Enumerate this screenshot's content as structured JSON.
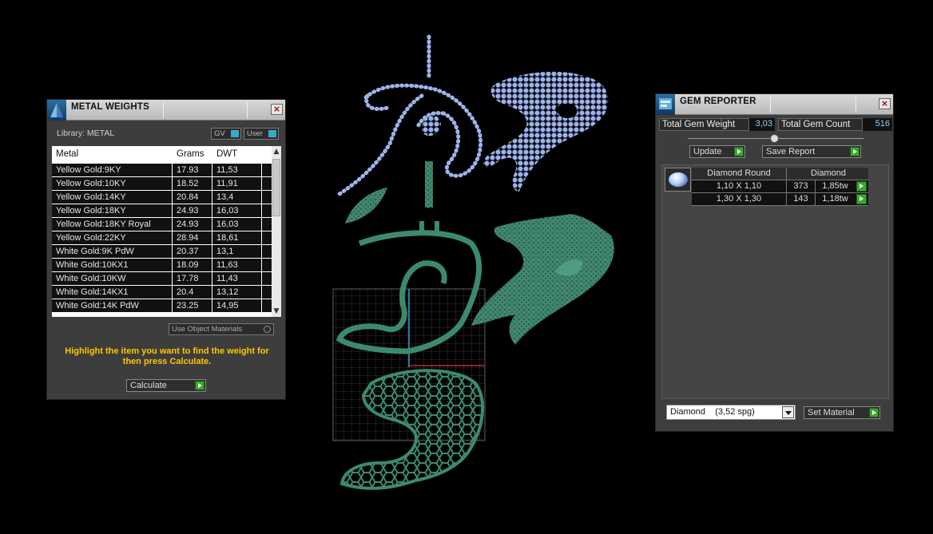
{
  "metal_weights": {
    "title": "METAL WEIGHTS",
    "library_label": "Library: METAL",
    "toggle_gv": "GV",
    "toggle_user": "User",
    "columns": [
      "Metal",
      "Grams",
      "DWT"
    ],
    "rows": [
      [
        "Yellow Gold:9KY",
        "17.93",
        "11,53"
      ],
      [
        "Yellow Gold:10KY",
        "18.52",
        "11,91"
      ],
      [
        "Yellow Gold:14KY",
        "20.84",
        "13,4"
      ],
      [
        "Yellow Gold:18KY",
        "24.93",
        "16,03"
      ],
      [
        "Yellow Gold:18KY Royal",
        "24.93",
        "16,03"
      ],
      [
        "Yellow Gold:22KY",
        "28.94",
        "18,61"
      ],
      [
        "White Gold:9K PdW",
        "20.37",
        "13,1"
      ],
      [
        "White Gold:10KX1",
        "18.09",
        "11,63"
      ],
      [
        "White Gold:10KW",
        "17.78",
        "11,43"
      ],
      [
        "White Gold:14KX1",
        "20.4",
        "13,12"
      ],
      [
        "White Gold:14K PdW",
        "23.25",
        "14,95"
      ]
    ],
    "use_object_materials": "Use Object Materials",
    "hint": "Highlight the item you want to find the weight for then press Calculate.",
    "calculate_label": "Calculate"
  },
  "gem_reporter": {
    "title": "GEM REPORTER",
    "total_weight_label": "Total Gem Weight",
    "total_weight_value": "3,03",
    "total_count_label": "Total Gem Count",
    "total_count_value": "516",
    "update_label": "Update",
    "save_report_label": "Save Report",
    "table_headers": [
      "Diamond Round",
      "Diamond"
    ],
    "rows": [
      [
        "1,10 X 1,10",
        "373",
        "1,85tw"
      ],
      [
        "1,30 X 1,30",
        "143",
        "1,18tw"
      ]
    ],
    "material_select": "Diamond    (3,52 spg)",
    "set_material_label": "Set Material"
  },
  "colors": {
    "panel_bg": "#3d3d3d",
    "hint_text": "#ffc600",
    "go_button": "#38a82e",
    "gem_blue": "#9eb3ea",
    "metal_green": "#3c8a6c"
  }
}
